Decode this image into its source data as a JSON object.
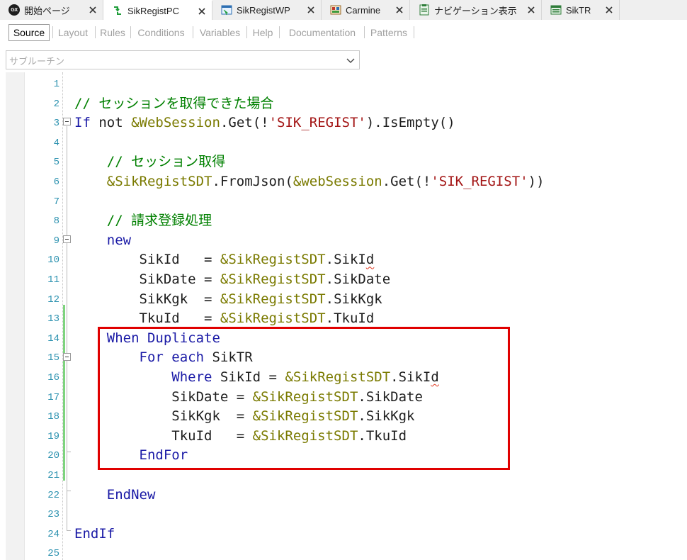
{
  "tabs": [
    {
      "label": "開始ページ",
      "icon": "genexus-logo-icon",
      "active": false
    },
    {
      "label": "SikRegistPC",
      "icon": "procedure-icon",
      "active": true
    },
    {
      "label": "SikRegistWP",
      "icon": "web-panel-icon",
      "active": false
    },
    {
      "label": "Carmine",
      "icon": "theme-icon",
      "active": false
    },
    {
      "label": "ナビゲーション表示",
      "icon": "navigation-icon",
      "active": false
    },
    {
      "label": "SikTR",
      "icon": "transaction-icon",
      "active": false
    }
  ],
  "parts": [
    "Source",
    "Layout",
    "Rules",
    "Conditions",
    "Variables",
    "Help",
    "Documentation",
    "Patterns"
  ],
  "combo": {
    "placeholder": "サブルーチン"
  },
  "gx_logo_text": "GX",
  "editor": {
    "line_numbers": [
      "1",
      "2",
      "3",
      "4",
      "5",
      "6",
      "7",
      "8",
      "9",
      "10",
      "11",
      "12",
      "13",
      "14",
      "15",
      "16",
      "17",
      "18",
      "19",
      "20",
      "21",
      "22",
      "23",
      "24",
      "25"
    ],
    "lines": [
      [],
      [
        {
          "t": "// セッションを取得できた場合",
          "c": "c"
        }
      ],
      [
        {
          "t": "If",
          "c": "k"
        },
        {
          "t": " not ",
          "c": "o"
        },
        {
          "t": "&WebSession",
          "c": "v"
        },
        {
          "t": ".Get(!",
          "c": "o"
        },
        {
          "t": "'SIK_REGIST'",
          "c": "s"
        },
        {
          "t": ").IsEmpty()",
          "c": "o"
        }
      ],
      [],
      [
        {
          "t": "    // セッション取得",
          "c": "c"
        }
      ],
      [
        {
          "t": "    ",
          "c": "o"
        },
        {
          "t": "&SikRegistSDT",
          "c": "v"
        },
        {
          "t": ".FromJson(",
          "c": "o"
        },
        {
          "t": "&webSession",
          "c": "v"
        },
        {
          "t": ".Get(!",
          "c": "o"
        },
        {
          "t": "'SIK_REGIST'",
          "c": "s"
        },
        {
          "t": "))",
          "c": "o"
        }
      ],
      [],
      [
        {
          "t": "    // 請求登録処理",
          "c": "c"
        }
      ],
      [
        {
          "t": "    ",
          "c": "o"
        },
        {
          "t": "new",
          "c": "k"
        }
      ],
      [
        {
          "t": "        SikId   = ",
          "c": "o"
        },
        {
          "t": "&SikRegistSDT",
          "c": "v"
        },
        {
          "t": ".SikI",
          "c": "o"
        },
        {
          "t": "d",
          "c": "sq"
        }
      ],
      [
        {
          "t": "        SikDate = ",
          "c": "o"
        },
        {
          "t": "&SikRegistSDT",
          "c": "v"
        },
        {
          "t": ".SikDate",
          "c": "o"
        }
      ],
      [
        {
          "t": "        SikKgk  = ",
          "c": "o"
        },
        {
          "t": "&SikRegistSDT",
          "c": "v"
        },
        {
          "t": ".SikKgk",
          "c": "o"
        }
      ],
      [
        {
          "t": "        TkuId   = ",
          "c": "o"
        },
        {
          "t": "&SikRegistSDT",
          "c": "v"
        },
        {
          "t": ".TkuId",
          "c": "o"
        }
      ],
      [
        {
          "t": "    ",
          "c": "o"
        },
        {
          "t": "When Duplicate",
          "c": "k"
        }
      ],
      [
        {
          "t": "        ",
          "c": "o"
        },
        {
          "t": "For each",
          "c": "k"
        },
        {
          "t": " SikTR",
          "c": "o"
        }
      ],
      [
        {
          "t": "            ",
          "c": "o"
        },
        {
          "t": "Where",
          "c": "k"
        },
        {
          "t": " SikId = ",
          "c": "o"
        },
        {
          "t": "&SikRegistSDT",
          "c": "v"
        },
        {
          "t": ".SikI",
          "c": "o"
        },
        {
          "t": "d",
          "c": "sq"
        }
      ],
      [
        {
          "t": "            SikDate = ",
          "c": "o"
        },
        {
          "t": "&SikRegistSDT",
          "c": "v"
        },
        {
          "t": ".SikDate",
          "c": "o"
        }
      ],
      [
        {
          "t": "            SikKgk  = ",
          "c": "o"
        },
        {
          "t": "&SikRegistSDT",
          "c": "v"
        },
        {
          "t": ".SikKgk",
          "c": "o"
        }
      ],
      [
        {
          "t": "            TkuId   = ",
          "c": "o"
        },
        {
          "t": "&SikRegistSDT",
          "c": "v"
        },
        {
          "t": ".TkuId",
          "c": "o"
        }
      ],
      [
        {
          "t": "        ",
          "c": "o"
        },
        {
          "t": "EndFor",
          "c": "k"
        }
      ],
      [],
      [
        {
          "t": "    ",
          "c": "o"
        },
        {
          "t": "EndNew",
          "c": "k"
        }
      ],
      [],
      [
        {
          "t": "EndIf",
          "c": "k"
        }
      ],
      []
    ]
  },
  "colors": {
    "keyword": "#1a1aa6",
    "variable": "#7a7a00",
    "string": "#a31515",
    "comment": "#008000",
    "line_number": "#2b91af",
    "highlight_box": "#e00000",
    "change_marker": "#7ed37e"
  }
}
